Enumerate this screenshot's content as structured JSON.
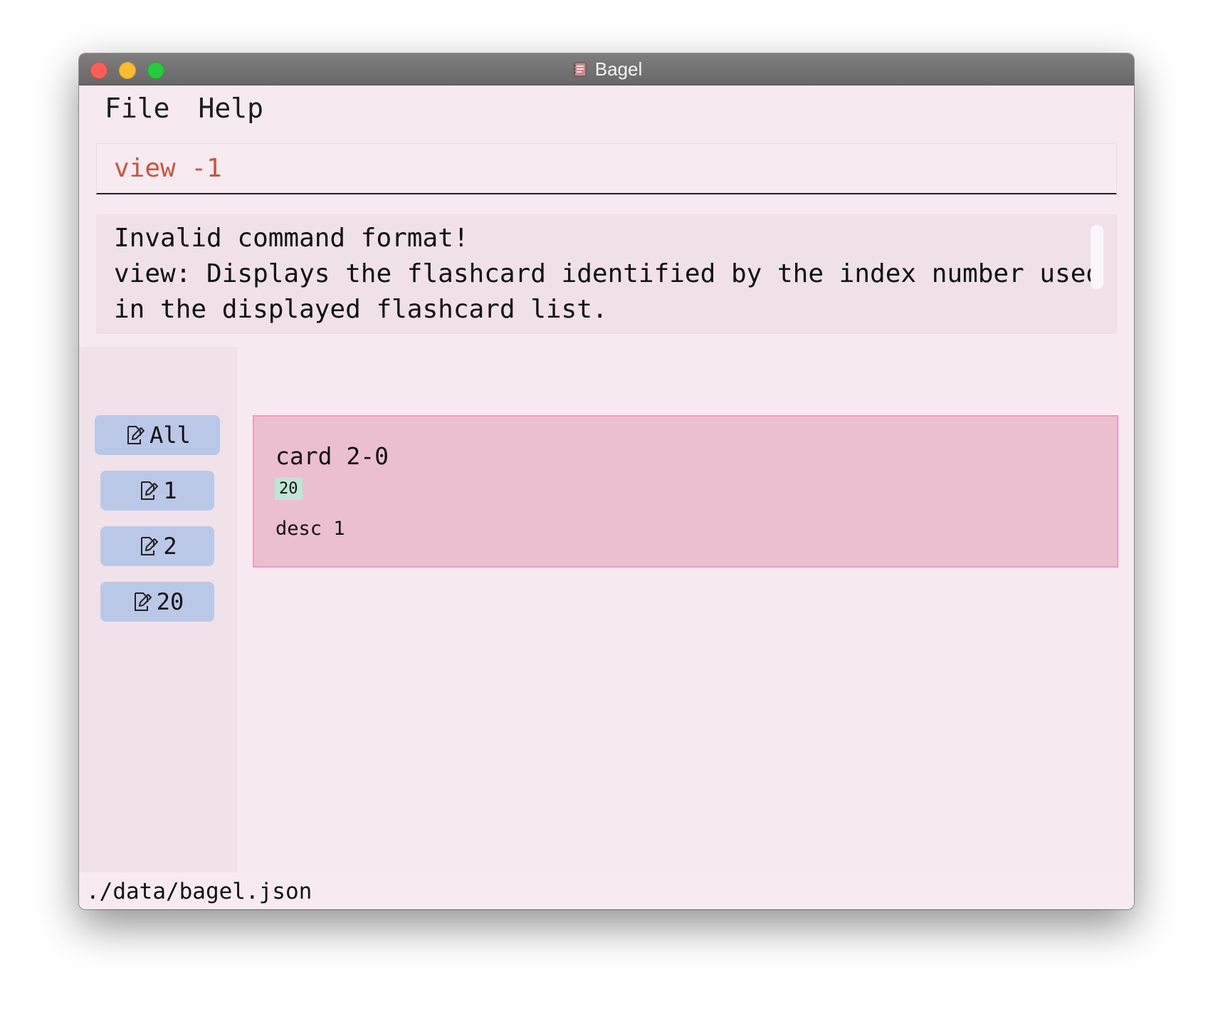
{
  "window": {
    "title": "Bagel",
    "app_icon": "bagel-app-icon"
  },
  "menu": {
    "items": [
      "File",
      "Help"
    ]
  },
  "command_box": {
    "value": "view -1"
  },
  "result_display": {
    "lines": [
      "Invalid command format!",
      "view: Displays the flashcard identified by the index number used",
      "in the displayed flashcard list."
    ]
  },
  "sidebar": {
    "decks": [
      {
        "label": "All",
        "icon": "edit-note-icon"
      },
      {
        "label": "1",
        "icon": "edit-note-icon"
      },
      {
        "label": "2",
        "icon": "edit-note-icon"
      },
      {
        "label": "20",
        "icon": "edit-note-icon"
      }
    ]
  },
  "flashcards": [
    {
      "title": "card 2-0",
      "tag": "20",
      "description": "desc 1"
    }
  ],
  "status_bar": {
    "path": "./data/bagel.json"
  },
  "colors": {
    "background": "#f6e9f0",
    "command_text": "#c9553f",
    "deck_button": "#b9c8e6",
    "card_background": "#ebbfcf",
    "card_border": "#f09bbd",
    "tag_background": "#bfe5d6"
  }
}
